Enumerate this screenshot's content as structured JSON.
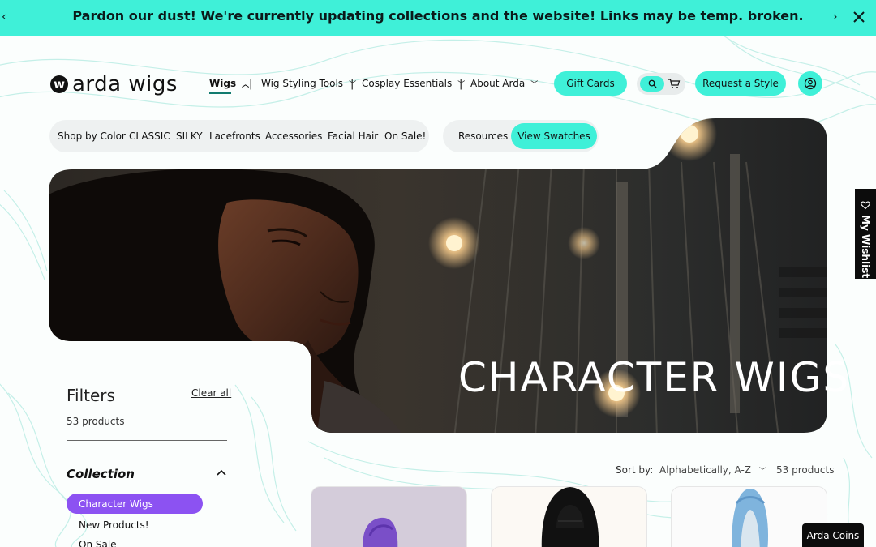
{
  "announcement": {
    "text": "Pardon our dust! We're currently updating collections and the website! Links may be temp. broken.",
    "prev_icon": "chevron-left-icon",
    "next_icon": "chevron-right-icon",
    "close_icon": "close-icon"
  },
  "brand": {
    "mark": "w",
    "name": "arda wigs"
  },
  "main_nav": {
    "items": [
      {
        "label": "Wigs",
        "active": true
      },
      {
        "label": "Wig Styling Tools"
      },
      {
        "label": "Cosplay Essentials"
      },
      {
        "label": "About Arda"
      }
    ],
    "separator": "|",
    "gift_cards": "Gift Cards",
    "request_style": "Request a Style"
  },
  "sub_nav": {
    "items": [
      "Shop by Color",
      "CLASSIC",
      "SILKY",
      "Lacefronts",
      "Accessories",
      "Facial Hair",
      "On Sale!"
    ],
    "resources": "Resources",
    "view_swatches": "View Swatches"
  },
  "hero": {
    "title": "CHARACTER WIGS"
  },
  "filters": {
    "title": "Filters",
    "clear_all": "Clear all",
    "product_count": "53 products",
    "collection": {
      "title": "Collection",
      "items": [
        "Character Wigs",
        "New Products!",
        "On Sale"
      ],
      "selected": "Character Wigs"
    }
  },
  "sort": {
    "label": "Sort by:",
    "value": "Alphabetically, A-Z",
    "count": "53 products"
  },
  "wishlist": {
    "label": "My Wishlist"
  },
  "coins": {
    "label": "Arda Coins"
  },
  "colors": {
    "accent": "#3ff0d8",
    "purple": "#8c52f2",
    "dark": "#0c0c0c",
    "nav_underline": "#127b6f"
  }
}
